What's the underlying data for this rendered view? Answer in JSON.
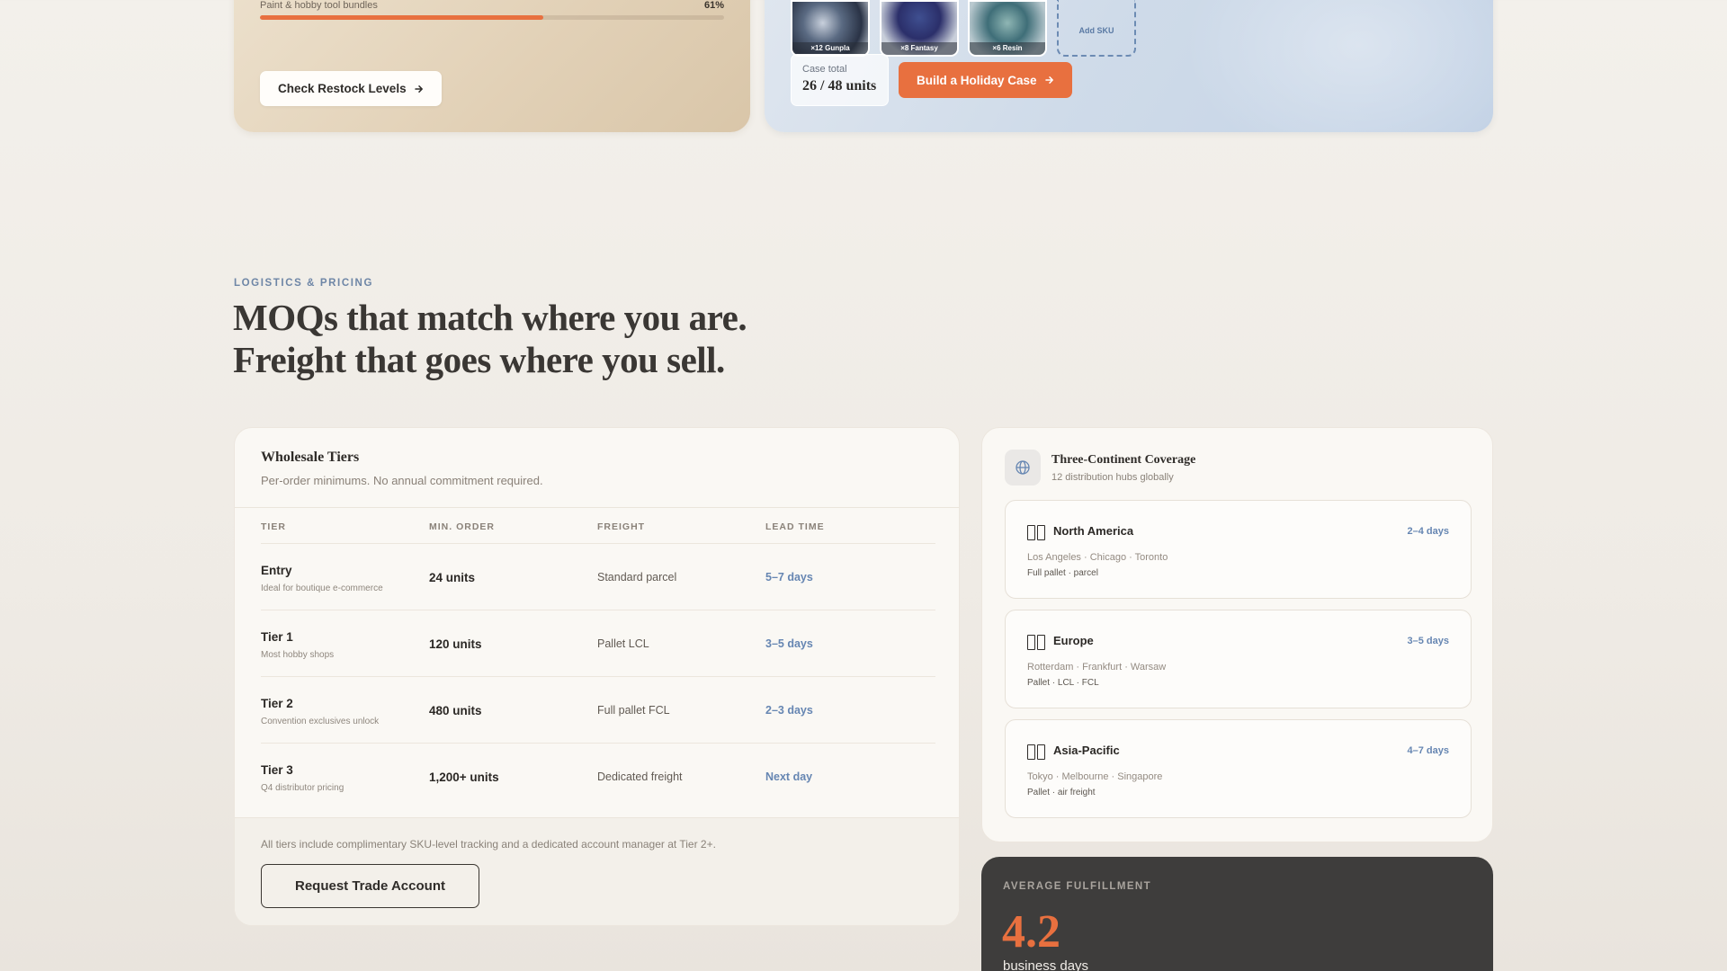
{
  "restock": {
    "bundle_label": "Paint & hobby tool bundles",
    "bundle_percent": "61%",
    "bundle_fraction": 0.61,
    "button_label": "Check Restock Levels",
    "button_icon": "arrow-right-icon"
  },
  "holiday_case": {
    "skus": [
      {
        "caption": "×12 Gunpla"
      },
      {
        "caption": "×8 Fantasy"
      },
      {
        "caption": "×6 Resin"
      }
    ],
    "add_sku_label": "Add SKU",
    "case_total_label": "Case total",
    "case_total_value": "26 / 48 units",
    "button_label": "Build a Holiday Case",
    "button_icon": "arrow-right-icon"
  },
  "section": {
    "eyebrow": "LOGISTICS & PRICING",
    "headline_line1": "MOQs that match where you are.",
    "headline_line2": "Freight that goes where you sell."
  },
  "tiers": {
    "title": "Wholesale Tiers",
    "subtitle": "Per-order minimums. No annual commitment required.",
    "columns": [
      "TIER",
      "MIN. ORDER",
      "FREIGHT",
      "LEAD TIME"
    ],
    "rows": [
      {
        "name": "Entry",
        "desc": "Ideal for boutique e-commerce",
        "moq": "24 units",
        "freight": "Standard parcel",
        "lead": "5–7 days"
      },
      {
        "name": "Tier 1",
        "desc": "Most hobby shops",
        "moq": "120 units",
        "freight": "Pallet LCL",
        "lead": "3–5 days"
      },
      {
        "name": "Tier 2",
        "desc": "Convention exclusives unlock",
        "moq": "480 units",
        "freight": "Full pallet FCL",
        "lead": "2–3 days"
      },
      {
        "name": "Tier 3",
        "desc": "Q4 distributor pricing",
        "moq": "1,200+ units",
        "freight": "Dedicated freight",
        "lead": "Next day"
      }
    ],
    "footnote": "All tiers include complimentary SKU-level tracking and a dedicated account manager at Tier 2+.",
    "button_label": "Request Trade Account"
  },
  "coverage": {
    "icon": "globe-icon",
    "title": "Three-Continent Coverage",
    "subtitle": "12 distribution hubs globally",
    "regions": [
      {
        "name": "North America",
        "days": "2–4 days",
        "cities": "Los Angeles · Chicago · Toronto",
        "modes": "Full pallet · parcel"
      },
      {
        "name": "Europe",
        "days": "3–5 days",
        "cities": "Rotterdam · Frankfurt · Warsaw",
        "modes": "Pallet · LCL · FCL"
      },
      {
        "name": "Asia-Pacific",
        "days": "4–7 days",
        "cities": "Tokyo · Melbourne · Singapore",
        "modes": "Pallet · air freight"
      }
    ]
  },
  "fulfillment": {
    "label": "AVERAGE FULFILLMENT",
    "value": "4.2",
    "unit": "business days"
  },
  "colors": {
    "accent": "#e8703f",
    "link_blue": "#6686b2",
    "dark_card": "#3e3d3c"
  }
}
